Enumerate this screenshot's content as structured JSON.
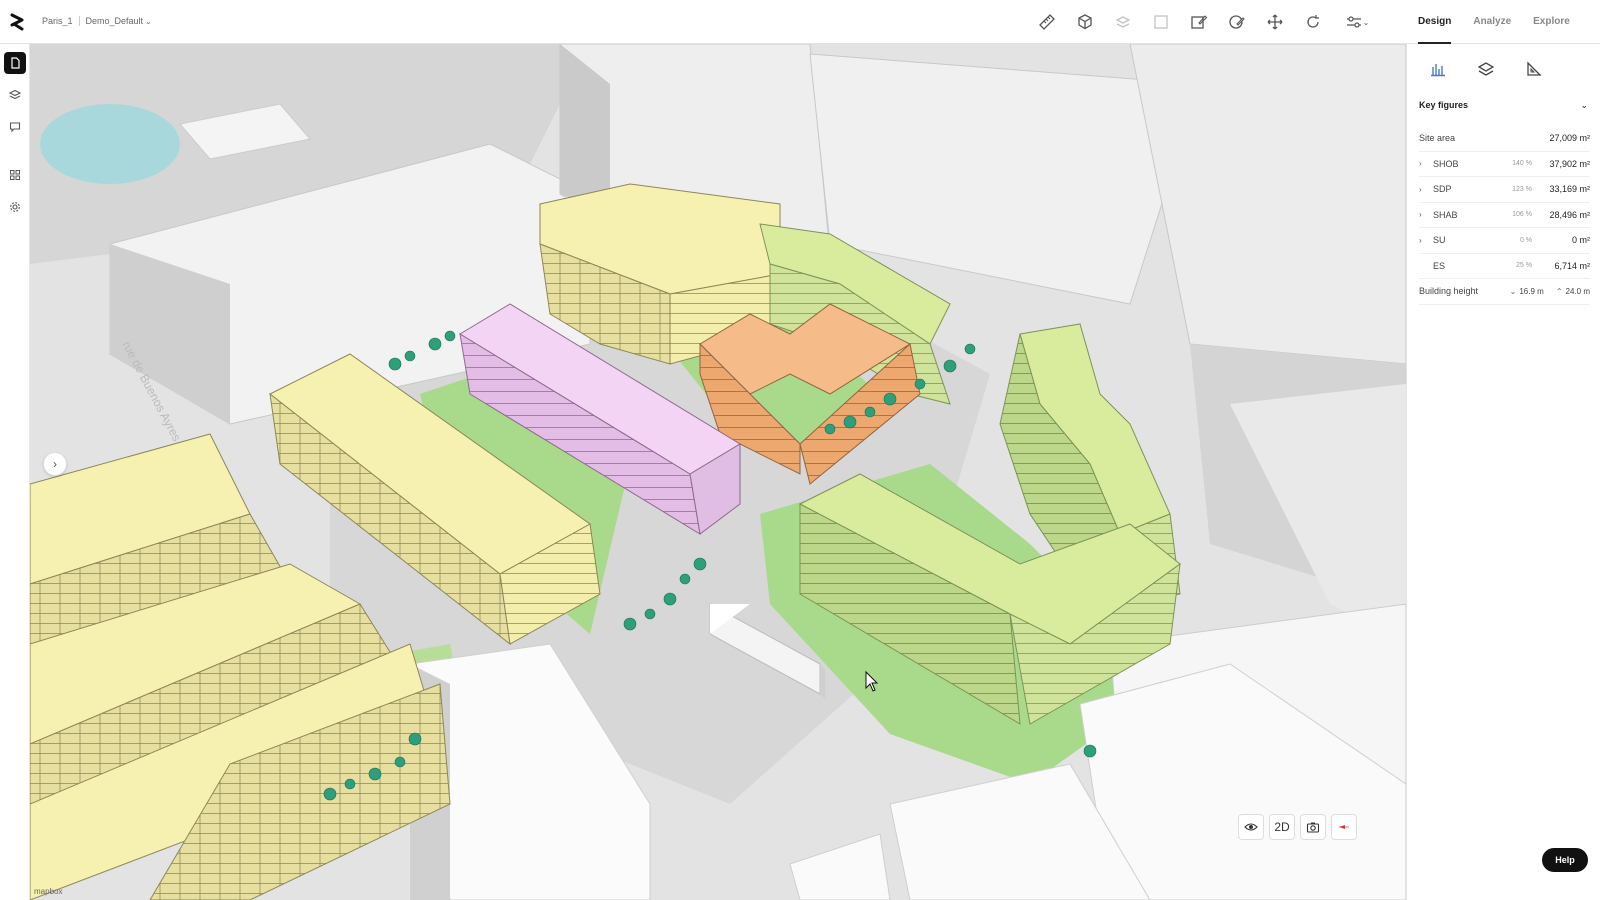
{
  "breadcrumb": {
    "project": "Paris_1",
    "scenario": "Demo_Default"
  },
  "tabs": [
    {
      "label": "Design",
      "active": true
    },
    {
      "label": "Analyze",
      "active": false
    },
    {
      "label": "Explore",
      "active": false
    }
  ],
  "panel": {
    "section_title": "Key figures",
    "site_area": {
      "label": "Site area",
      "value": "27,009 m²"
    },
    "metrics": [
      {
        "label": "SHOB",
        "pct": "140 %",
        "value": "37,902 m²",
        "expandable": true
      },
      {
        "label": "SDP",
        "pct": "123 %",
        "value": "33,169 m²",
        "expandable": true
      },
      {
        "label": "SHAB",
        "pct": "106 %",
        "value": "28,496 m²",
        "expandable": true
      },
      {
        "label": "SU",
        "pct": "0 %",
        "value": "0 m²",
        "expandable": true
      },
      {
        "label": "ES",
        "pct": "25 %",
        "value": "6,714 m²",
        "expandable": false
      }
    ],
    "building_height": {
      "label": "Building height",
      "min": "16.9 m",
      "max": "24.0 m"
    }
  },
  "map": {
    "attribution": "mapbox",
    "street_label": "rue de Buenos Ayres",
    "view_mode": "2D"
  },
  "help_label": "Help",
  "colors": {
    "yellow_building": "#f2eda0",
    "green_building": "#cfe59a",
    "pink_building": "#efcdef",
    "orange_building": "#f2b27a",
    "green_space": "#a9d98a"
  }
}
